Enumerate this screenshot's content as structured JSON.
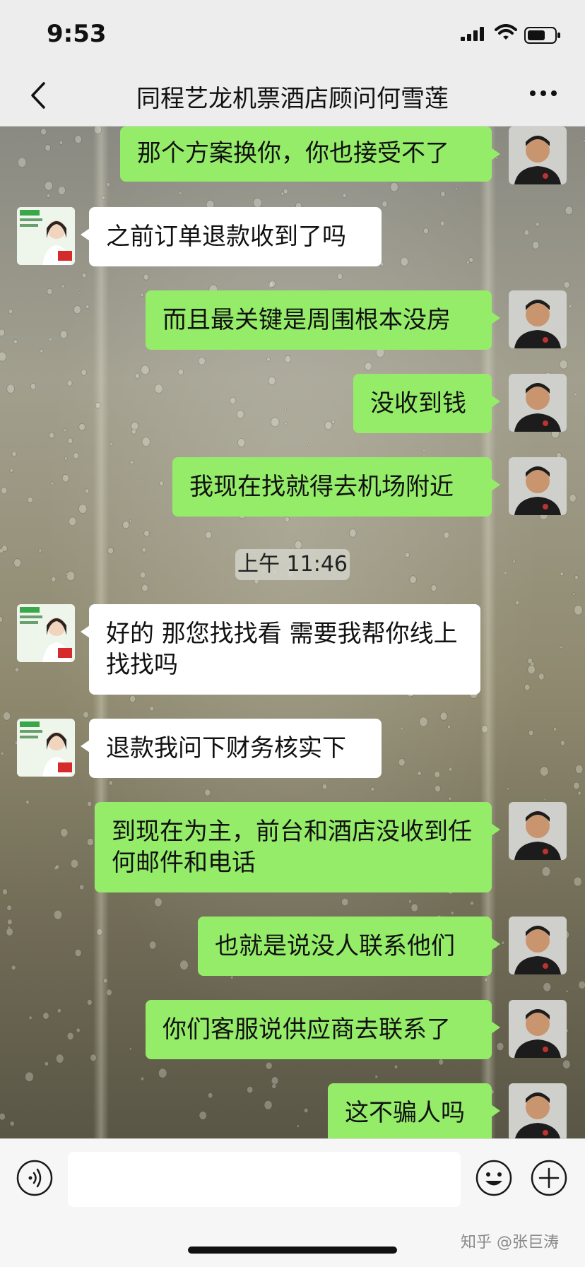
{
  "status": {
    "time": "9:53"
  },
  "header": {
    "title": "同程艺龙机票酒店顾问何雪莲"
  },
  "messages": [
    {
      "from": "me",
      "text": "那个方案换你，你也接受不了"
    },
    {
      "from": "them",
      "text": "之前订单退款收到了吗"
    },
    {
      "from": "me",
      "text": "而且最关键是周围根本没房"
    },
    {
      "from": "me",
      "text": "没收到钱"
    },
    {
      "from": "me",
      "text": "我现在找就得去机场附近"
    },
    {
      "from": "them",
      "text": "好的 那您找找看  需要我帮你线上找找吗"
    },
    {
      "from": "them",
      "text": "退款我问下财务核实下"
    },
    {
      "from": "me",
      "text": "到现在为主，前台和酒店没收到任何邮件和电话"
    },
    {
      "from": "me",
      "text": "也就是说没人联系他们"
    },
    {
      "from": "me",
      "text": "你们客服说供应商去联系了"
    },
    {
      "from": "me",
      "text": "这不骗人吗"
    }
  ],
  "timestamp": "上午 11:46",
  "watermark": "知乎 @张巨涛",
  "colors": {
    "my_bubble": "#95ec69",
    "their_bubble": "#ffffff",
    "bar_bg": "#ededed"
  },
  "icons": [
    "back-chevron-icon",
    "more-dots-icon",
    "signal-icon",
    "wifi-icon",
    "battery-icon",
    "voice-icon",
    "emoji-icon",
    "plus-icon"
  ]
}
